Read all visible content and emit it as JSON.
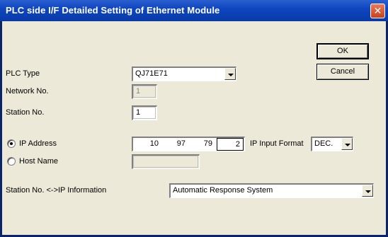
{
  "window": {
    "title": "PLC side I/F Detailed Setting of Ethernet Module",
    "close_glyph": "✕"
  },
  "buttons": {
    "ok": "OK",
    "cancel": "Cancel"
  },
  "plc_type": {
    "label": "PLC Type",
    "value": "QJ71E71"
  },
  "network_no": {
    "label": "Network No.",
    "value": "1",
    "enabled": false
  },
  "station_no": {
    "label": "Station No.",
    "value": "1"
  },
  "addressing": {
    "ip_option_label": "IP Address",
    "ip_selected": true,
    "ip_octets": [
      "10",
      "97",
      "79",
      "2"
    ],
    "ip_input_format_label": "IP Input Format",
    "ip_input_format_value": "DEC.",
    "host_option_label": "Host Name",
    "host_value": ""
  },
  "station_ip_info": {
    "label": "Station No. <->IP Information",
    "value": "Automatic Response System"
  }
}
